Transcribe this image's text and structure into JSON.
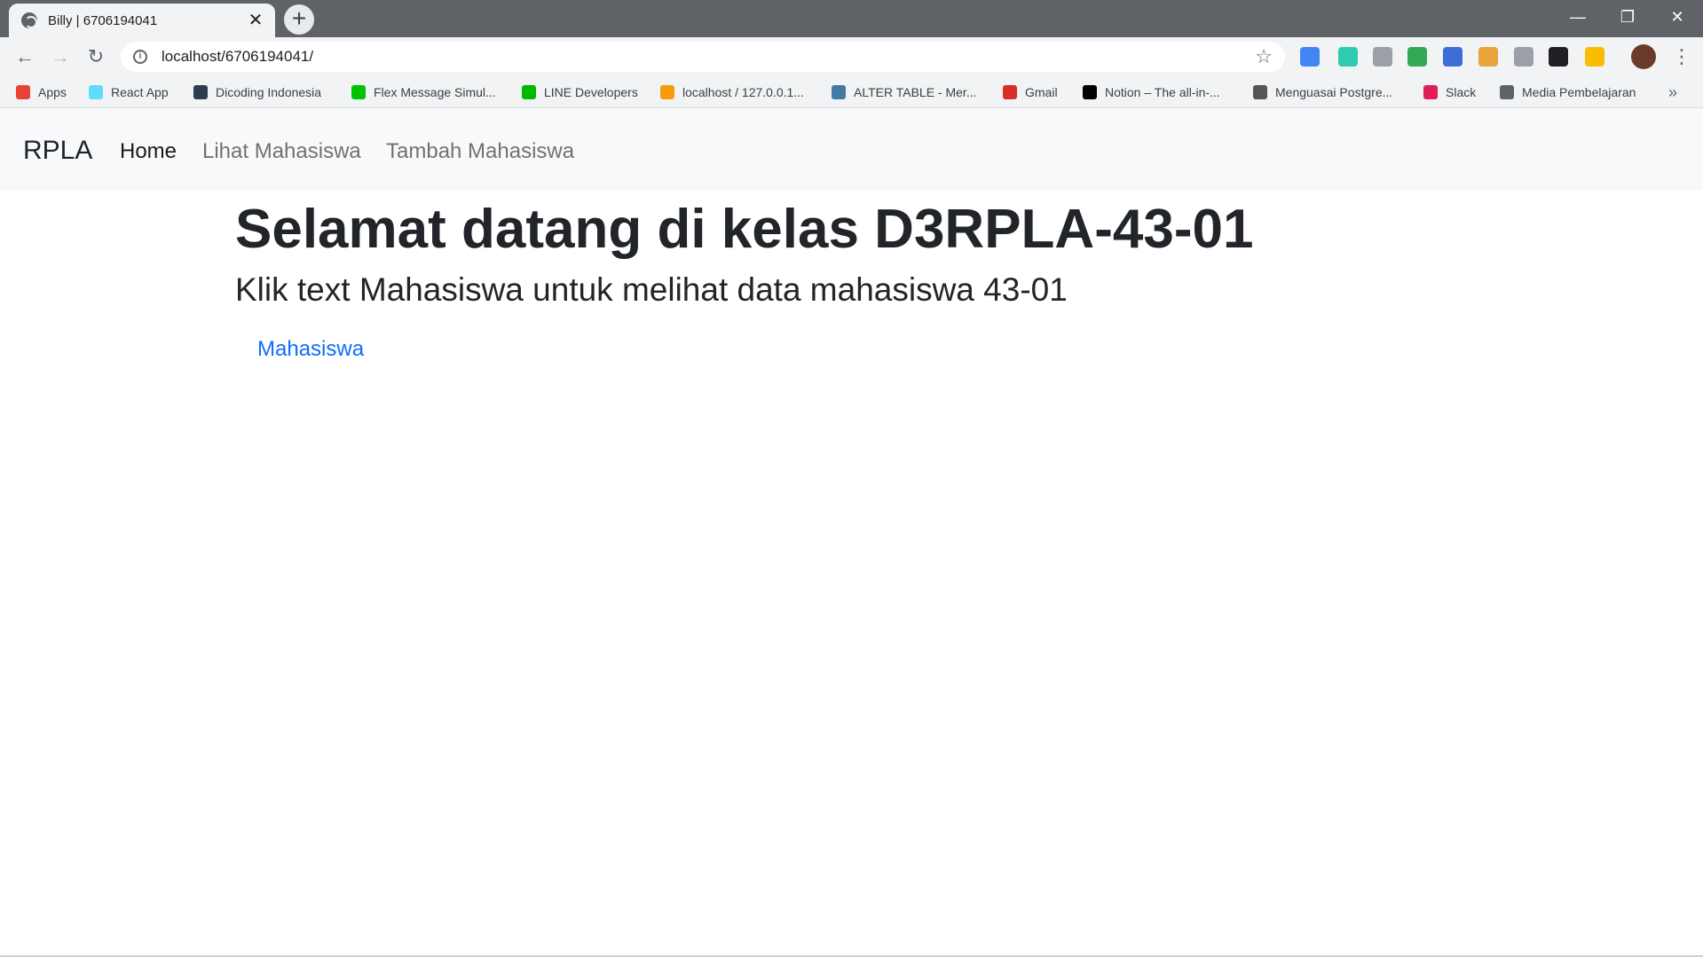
{
  "browser": {
    "tab_title": "Billy | 6706194041",
    "tab_close": "✕",
    "new_tab": "+",
    "url": "localhost/6706194041/",
    "window_controls": {
      "minimize": "—",
      "restore": "❐",
      "close": "✕"
    },
    "nav": {
      "back": "←",
      "forward": "→",
      "reload": "↻"
    },
    "star": "☆",
    "menu": "⋮",
    "bookmarks_more": "»",
    "bookmarks": [
      {
        "label": "Apps",
        "icon": "apps-grid-icon",
        "color": "#ea4335"
      },
      {
        "label": "React App",
        "icon": "react-icon",
        "color": "#61dafb"
      },
      {
        "label": "Dicoding Indonesia",
        "icon": "dicoding-icon",
        "color": "#2d3e50"
      },
      {
        "label": "Flex Message Simul...",
        "icon": "line-flex-icon",
        "color": "#00c300"
      },
      {
        "label": "LINE Developers",
        "icon": "line-icon",
        "color": "#00b900"
      },
      {
        "label": "localhost / 127.0.0.1...",
        "icon": "phpmyadmin-icon",
        "color": "#f89c0e"
      },
      {
        "label": "ALTER TABLE - Mer...",
        "icon": "mysql-icon",
        "color": "#4479a1"
      },
      {
        "label": "Gmail",
        "icon": "gmail-icon",
        "color": "#d93025"
      },
      {
        "label": "Notion – The all-in-...",
        "icon": "notion-icon",
        "color": "#000000"
      },
      {
        "label": "Menguasai Postgre...",
        "icon": "feather-icon",
        "color": "#555555"
      },
      {
        "label": "Slack",
        "icon": "slack-icon",
        "color": "#e01e5a"
      },
      {
        "label": "Media Pembelajaran",
        "icon": "globe-icon",
        "color": "#5f6368"
      }
    ],
    "extensions": [
      {
        "icon": "translate-extension-icon",
        "color": "#4285f4"
      },
      {
        "icon": "speed-extension-icon",
        "color": "#2ecbb0"
      },
      {
        "icon": "cast-extension-icon",
        "color": "#9aa0a6"
      },
      {
        "icon": "globe-extension-icon",
        "color": "#34a853"
      },
      {
        "icon": "chat-extension-icon",
        "color": "#3b6fd6"
      },
      {
        "icon": "cookie-extension-icon",
        "color": "#e8a33b"
      },
      {
        "icon": "settings-extension-icon",
        "color": "#9aa0a6"
      },
      {
        "icon": "font-extension-icon",
        "color": "#202124"
      },
      {
        "icon": "star-extension-icon",
        "color": "#fbbc04"
      }
    ]
  },
  "navbar": {
    "brand": "RPLA",
    "links": [
      {
        "label": "Home",
        "active": true
      },
      {
        "label": "Lihat Mahasiswa",
        "active": false
      },
      {
        "label": "Tambah Mahasiswa",
        "active": false
      }
    ]
  },
  "main": {
    "heading": "Selamat datang di kelas D3RPLA-43-01",
    "subheading": "Klik text Mahasiswa untuk melihat data mahasiswa 43-01",
    "link": "Mahasiswa"
  }
}
